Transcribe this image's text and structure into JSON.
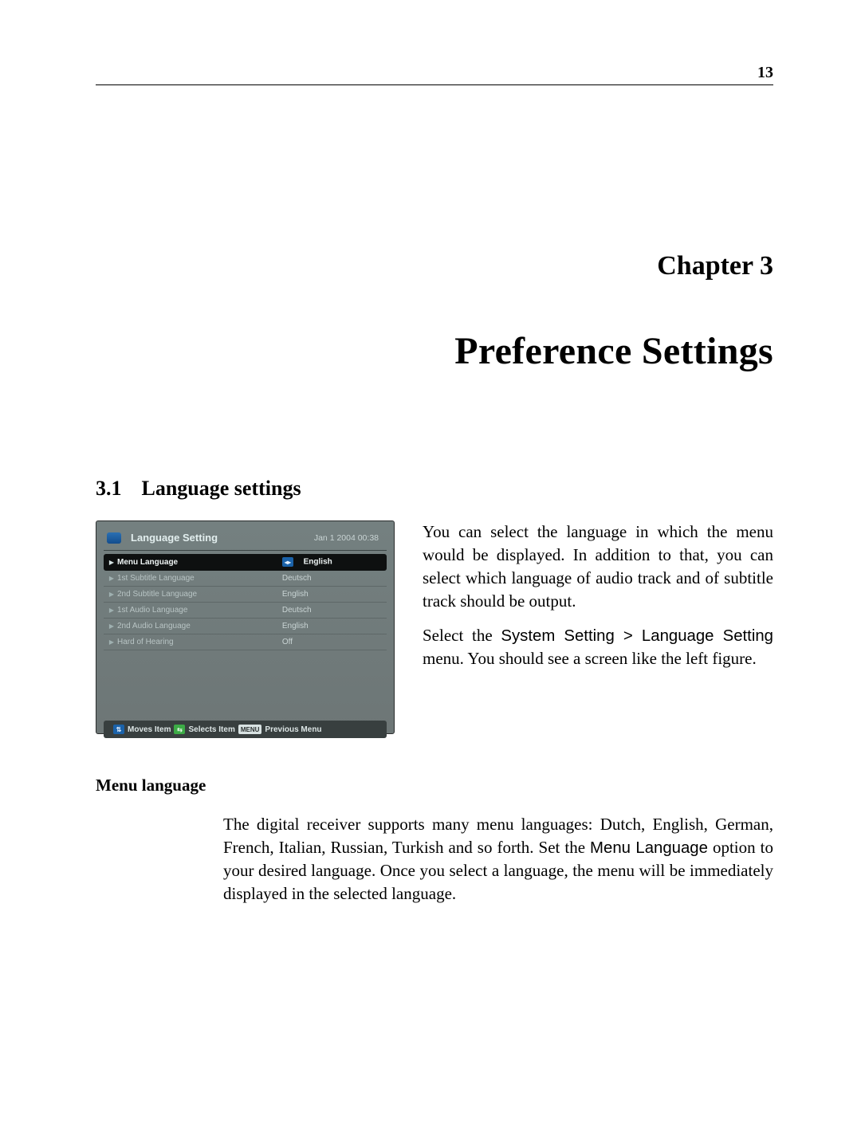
{
  "page_number": "13",
  "chapter_label": "Chapter 3",
  "chapter_title": "Preference Settings",
  "section": {
    "number": "3.1",
    "title": "Language settings"
  },
  "osd": {
    "title": "Language Setting",
    "datetime": "Jan 1 2004 00:38",
    "rows": [
      {
        "label": "Menu Language",
        "value": "English",
        "selected": true
      },
      {
        "label": "1st Subtitle Language",
        "value": "Deutsch",
        "selected": false
      },
      {
        "label": "2nd Subtitle Language",
        "value": "English",
        "selected": false
      },
      {
        "label": "1st Audio Language",
        "value": "Deutsch",
        "selected": false
      },
      {
        "label": "2nd Audio Language",
        "value": "English",
        "selected": false
      },
      {
        "label": "Hard of Hearing",
        "value": "Off",
        "selected": false
      }
    ],
    "hints": {
      "moves": "Moves Item",
      "selects": "Selects Item",
      "menu_key": "MENU",
      "previous": "Previous Menu"
    }
  },
  "rcol": {
    "p1": "You can select the language in which the menu would be dis­played. In addition to that, you can select which language of au­dio track and of subtitle track should be output.",
    "p2a": "Select the ",
    "p2b_sans": "System Setting > Lan­guage Setting",
    "p2c": " menu. You should see a screen like the left figure."
  },
  "subhead": "Menu language",
  "body": {
    "t1": "The digital receiver supports many menu languages: Dutch, English, German, French, Italian, Russian, Turkish and so forth. Set the ",
    "t2_sans": "Menu Language",
    "t3": " option to your desired language. Once you select a language, the menu will be immediately displayed in the selected language."
  }
}
